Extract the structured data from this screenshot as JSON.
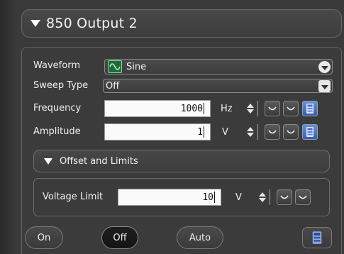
{
  "header": {
    "title": "850 Output 2"
  },
  "rows": {
    "waveform": {
      "label": "Waveform",
      "value": "Sine"
    },
    "sweep_type": {
      "label": "Sweep Type",
      "value": "Off"
    },
    "frequency": {
      "label": "Frequency",
      "value": "1000",
      "unit": "Hz"
    },
    "amplitude": {
      "label": "Amplitude",
      "value": "1",
      "unit": "V"
    }
  },
  "offset_section": {
    "title": "Offset and Limits",
    "voltage_limit": {
      "label": "Voltage Limit",
      "value": "10",
      "unit": "V"
    }
  },
  "buttons": {
    "on": "On",
    "off": "Off",
    "auto": "Auto",
    "active": "Off"
  },
  "icons": {
    "title_toggle": "triangle-down-icon",
    "waveform": "sine-wave-icon",
    "dropdown": "chevron-down-icon",
    "spinner": "spin-up-down-icon",
    "step_down": "step-down-icon",
    "step_up": "step-up-icon",
    "calculator": "calculator-icon"
  },
  "colors": {
    "accent_green": "#1f6b3a",
    "calc_blue": "#4a6fc0",
    "background": "#3b3b3b"
  }
}
